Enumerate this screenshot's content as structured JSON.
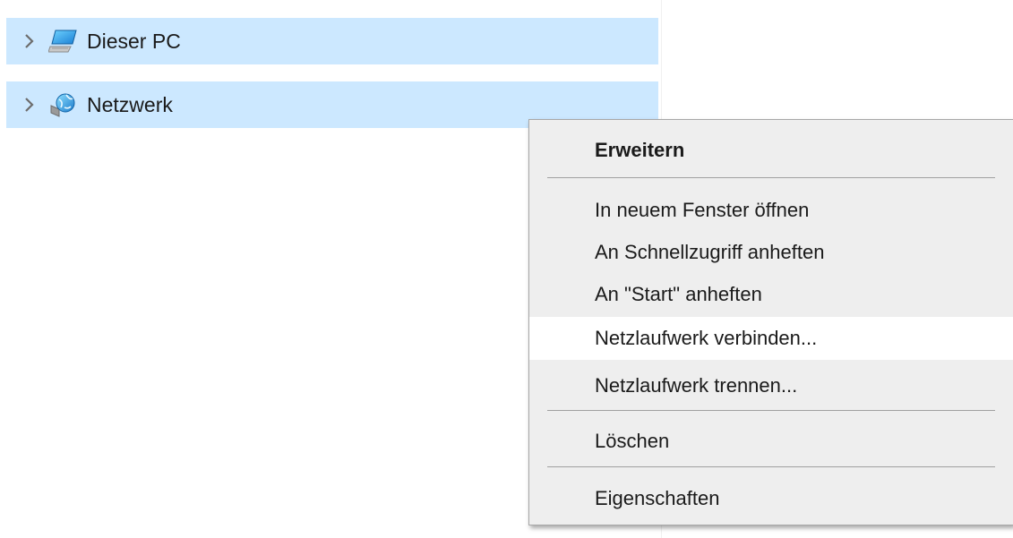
{
  "tree": {
    "items": [
      {
        "label": "Dieser PC",
        "icon": "computer-icon"
      },
      {
        "label": "Netzwerk",
        "icon": "network-icon"
      }
    ]
  },
  "context_menu": {
    "items": [
      {
        "label": "Erweitern",
        "bold": true
      },
      {
        "label": "In neuem Fenster öffnen"
      },
      {
        "label": "An Schnellzugriff anheften"
      },
      {
        "label": "An \"Start\" anheften"
      },
      {
        "label": "Netzlaufwerk verbinden...",
        "highlighted": true
      },
      {
        "label": "Netzlaufwerk trennen..."
      },
      {
        "label": "Löschen"
      },
      {
        "label": "Eigenschaften"
      }
    ]
  },
  "colors": {
    "selection": "#cce8ff",
    "menu_background": "#eeeeee",
    "menu_hover": "#ffffff",
    "separator": "#a0a0a0"
  }
}
